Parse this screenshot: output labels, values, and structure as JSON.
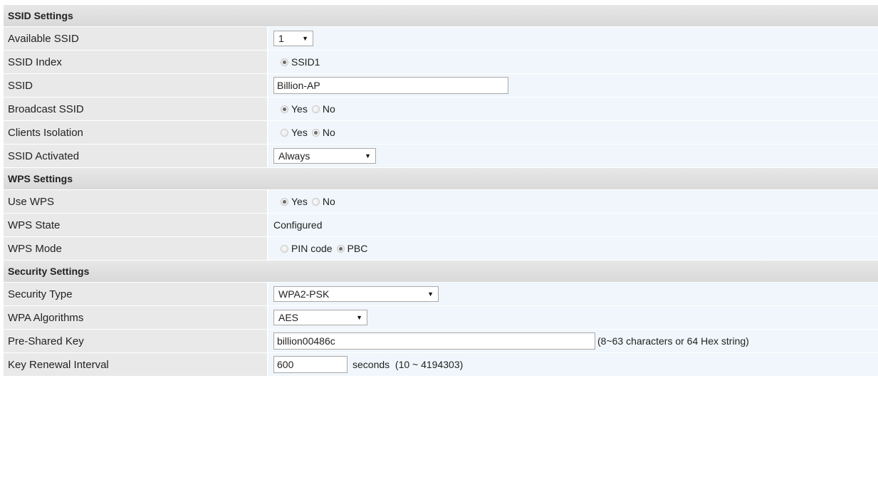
{
  "sections": {
    "ssid": "SSID Settings",
    "wps": "WPS Settings",
    "security": "Security Settings"
  },
  "ssid": {
    "available_label": "Available SSID",
    "available_value": "1",
    "index_label": "SSID Index",
    "index_option": "SSID1",
    "ssid_label": "SSID",
    "ssid_value": "Billion-AP",
    "broadcast_label": "Broadcast SSID",
    "isolation_label": "Clients Isolation",
    "activated_label": "SSID Activated",
    "activated_value": "Always"
  },
  "options": {
    "yes": "Yes",
    "no": "No"
  },
  "wps": {
    "use_label": "Use WPS",
    "state_label": "WPS State",
    "state_value": "Configured",
    "mode_label": "WPS Mode",
    "mode_pin": "PIN code",
    "mode_pbc": "PBC"
  },
  "security": {
    "type_label": "Security Type",
    "type_value": "WPA2-PSK",
    "algo_label": "WPA Algorithms",
    "algo_value": "AES",
    "psk_label": "Pre-Shared Key",
    "psk_value": "billion00486c",
    "psk_hint": "(8~63 characters or 64 Hex string)",
    "renewal_label": "Key Renewal Interval",
    "renewal_value": "600",
    "renewal_hint": "seconds  (10 ~ 4194303)"
  },
  "icons": {
    "dropdown": "chevron-down-icon",
    "radio": "radio-icon"
  },
  "colors": {
    "label_bg": "#e9e9e9",
    "value_bg": "#f0f6fb",
    "section_bg": "#dedede"
  }
}
